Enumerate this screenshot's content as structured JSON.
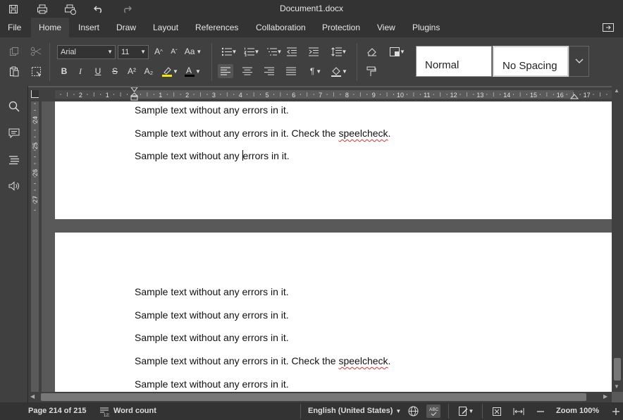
{
  "window": {
    "title": "Document1.docx"
  },
  "menu": {
    "tabs": [
      {
        "label": "File"
      },
      {
        "label": "Home"
      },
      {
        "label": "Insert"
      },
      {
        "label": "Draw"
      },
      {
        "label": "Layout"
      },
      {
        "label": "References"
      },
      {
        "label": "Collaboration"
      },
      {
        "label": "Protection"
      },
      {
        "label": "View"
      },
      {
        "label": "Plugins"
      }
    ],
    "active": "Home"
  },
  "toolbar": {
    "font_name": "Arial",
    "font_size": "11",
    "bold": "B",
    "italic": "I",
    "underline": "U",
    "strike": "S",
    "superscript": "A²",
    "subscript": "A₂",
    "increase_font": "A",
    "decrease_font": "A",
    "change_case": "Aa",
    "highlight_color": "#f5e800",
    "font_color": "#000000"
  },
  "styles": [
    {
      "label": "Normal"
    },
    {
      "label": "No Spacing"
    }
  ],
  "ruler": {
    "h_ticks": [
      "2",
      "1",
      "1",
      "2",
      "3",
      "4",
      "5",
      "6",
      "7",
      "8",
      "9",
      "10",
      "11",
      "12",
      "13",
      "14",
      "15",
      "16",
      "17"
    ],
    "v_ticks": [
      "24",
      "25",
      "26",
      "27"
    ]
  },
  "document": {
    "plain": "Sample text without any errors in it.",
    "check_prefix": "Sample text without any errors in it. Check the ",
    "misspelled": "speelcheck",
    "period": ".",
    "caret_before": "Sample text without any ",
    "caret_after": "errors in it."
  },
  "status": {
    "page": "Page 214 of 215",
    "word_count": "Word count",
    "language": "English (United States)",
    "zoom": "Zoom 100%"
  }
}
